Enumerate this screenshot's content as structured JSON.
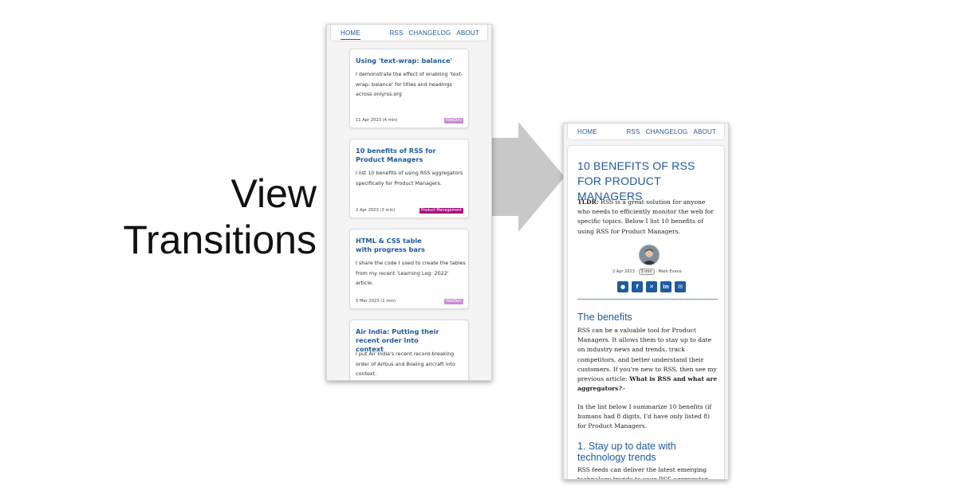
{
  "headline": {
    "line1": "View",
    "line2": "Transitions"
  },
  "nav": {
    "home": "HOME",
    "rss": "RSS",
    "changelog": "CHANGELOG",
    "about": "ABOUT"
  },
  "cards": [
    {
      "title": "Using 'text-wrap: balance'",
      "desc": "I demonstrate the effect of enabling 'text-wrap: balance' for titles and headings across onlyrss.org",
      "date": "11 Apr 2023 (4 min)",
      "badge": "WebDev",
      "badge_color": "#c98bd1"
    },
    {
      "title": "10 benefits of RSS for Product Managers",
      "desc": "I list 10 benefits of using RSS aggregators specifically for Product Managers.",
      "date": "2 Apr 2023 (3 min)",
      "badge": "Product Management",
      "badge_color": "#a3117f"
    },
    {
      "title": "HTML & CSS table with progress bars",
      "desc": "I share the code I used to create the tables from my recent 'Learning Log: 2022' article.",
      "date": "5 Mar 2023 (1 min)",
      "badge": "WebDev",
      "badge_color": "#c98bd1"
    },
    {
      "title": "Air India: Putting their recent order into context",
      "desc": "I put Air India's recent record-breaking order of Airbus and Boeing aircraft into context.",
      "date": "",
      "badge": "",
      "badge_color": "#c98bd1"
    }
  ],
  "article": {
    "title": "10 BENEFITS OF RSS FOR PRODUCT MANAGERS",
    "tldr_label": "TLDR:",
    "tldr": " RSS is a great solution for anyone who needs to efficiently monitor the web for specific topics. Below I list 10 benefits of using RSS for Product Managers.",
    "meta_date": "2 Apr 2023 ·",
    "meta_min": "3 min",
    "meta_author": "· Mark Evans·",
    "h_benefits": "The benefits",
    "p1": "RSS can be a valuable tool for Product Managers. It allows them to stay up to date on industry news and trends, track competitors, and better understand their customers. If you're new to RSS, then see my previous article: ",
    "p1_link": "What is RSS and what are aggregators?",
    "p1_end": "↗",
    "p2": "In the list below I summarize 10 benefits (if humans had 8 digits, I'd have only listed 8) for Product Managers.",
    "h_one": "1. Stay up to date with technology trends",
    "p3": "RSS feeds can deliver the latest emerging technology trends to your RSS aggregator."
  },
  "colors": {
    "accent": "#1e5aa0",
    "arrow": "#c8c8c8"
  }
}
